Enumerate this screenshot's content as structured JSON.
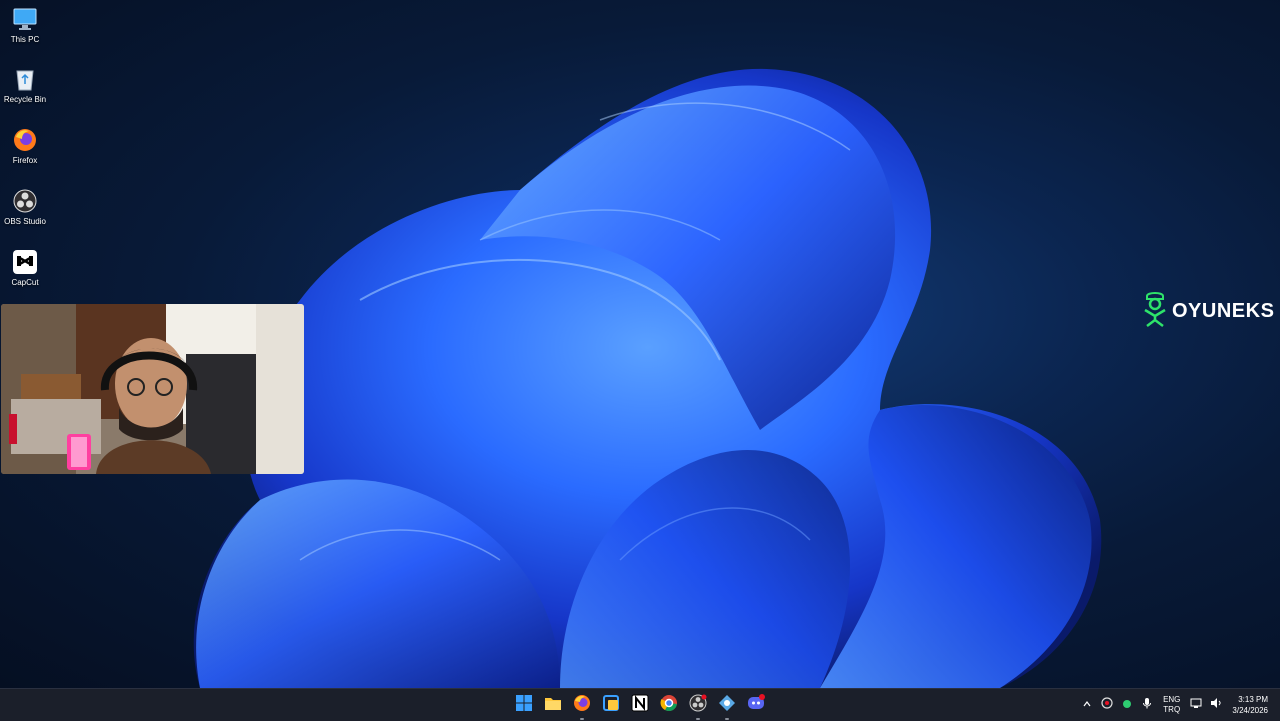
{
  "desktop_icons": [
    {
      "label": "This PC",
      "icon": "monitor-icon"
    },
    {
      "label": "Recycle Bin",
      "icon": "recycle-bin-icon"
    },
    {
      "label": "Firefox",
      "icon": "firefox-icon"
    },
    {
      "label": "OBS Studio",
      "icon": "obs-icon"
    },
    {
      "label": "CapCut",
      "icon": "capcut-icon"
    }
  ],
  "brand": {
    "text": "OYUNEKS"
  },
  "taskbar": {
    "apps": [
      "start-icon",
      "file-explorer-icon",
      "firefox-icon",
      "snipping-tool-icon",
      "notion-icon",
      "chrome-icon",
      "obs-icon",
      "network-app-icon",
      "discord-icon"
    ],
    "tray": {
      "language_line1": "ENG",
      "language_line2": "TRQ",
      "time": "3:13 PM",
      "date": "3/24/2026"
    }
  },
  "colors": {
    "wallpaper_bloom": "#1d5bff",
    "taskbar": "#1b1f2a",
    "brand": "#ffffff"
  }
}
